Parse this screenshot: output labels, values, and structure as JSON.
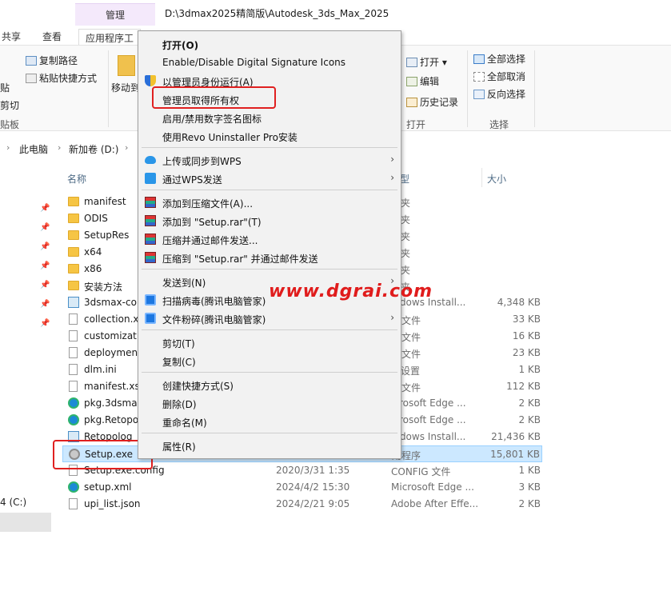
{
  "window": {
    "manage_tab": "管理",
    "title": "D:\\3dmax2025精简版\\Autodesk_3ds_Max_2025",
    "tabs": [
      "共享",
      "查看",
      "应用程序工"
    ]
  },
  "ribbon": {
    "copy_path": "复制路径",
    "paste_shortcut": "粘贴快捷方式",
    "paste_partial": "贴",
    "cut": "剪切",
    "clipboard_label": "贴板",
    "move_to": "移动到",
    "open": "打开",
    "edit": "编辑",
    "history": "历史记录",
    "open_group": "打开",
    "select_all": "全部选择",
    "select_none": "全部取消",
    "invert_select": "反向选择",
    "select_group": "选择"
  },
  "address": {
    "pc": "此电脑",
    "drive": "新加卷 (D:)"
  },
  "nav": {
    "drive_c": "4 (C:)"
  },
  "columns": {
    "name": "名称",
    "type": "型",
    "size": "大小"
  },
  "files": [
    {
      "name": "manifest",
      "date": "",
      "type": "件夹",
      "size": "",
      "icon": "folder"
    },
    {
      "name": "ODIS",
      "date": "",
      "type": "件夹",
      "size": "",
      "icon": "folder"
    },
    {
      "name": "SetupRes",
      "date": "",
      "type": "件夹",
      "size": "",
      "icon": "folder"
    },
    {
      "name": "x64",
      "date": "",
      "type": "件夹",
      "size": "",
      "icon": "folder"
    },
    {
      "name": "x86",
      "date": "",
      "type": "件夹",
      "size": "",
      "icon": "folder"
    },
    {
      "name": "安装方法",
      "date": "",
      "type": "件夹",
      "size": "",
      "icon": "folder"
    },
    {
      "name": "3dsmax-co",
      "date": "",
      "type": "indows Install...",
      "size": "4,348 KB",
      "icon": "package"
    },
    {
      "name": "collection.x",
      "date": "",
      "type": "D 文件",
      "size": "33 KB",
      "icon": "doc"
    },
    {
      "name": "customizat",
      "date": "",
      "type": "D 文件",
      "size": "16 KB",
      "icon": "doc"
    },
    {
      "name": "deploymen",
      "date": "",
      "type": "D 文件",
      "size": "23 KB",
      "icon": "doc"
    },
    {
      "name": "dlm.ini",
      "date": "",
      "type": "置设置",
      "size": "1 KB",
      "icon": "doc"
    },
    {
      "name": "manifest.xs",
      "date": "",
      "type": "D 文件",
      "size": "112 KB",
      "icon": "doc"
    },
    {
      "name": "pkg.3dsma",
      "date": "",
      "type": "icrosoft Edge ...",
      "size": "2 KB",
      "icon": "edge"
    },
    {
      "name": "pkg.Retopo",
      "date": "",
      "type": "icrosoft Edge ...",
      "size": "2 KB",
      "icon": "edge"
    },
    {
      "name": "Retopolog",
      "date": "",
      "type": "indows Install...",
      "size": "21,436 KB",
      "icon": "package"
    },
    {
      "name": "Setup.exe",
      "date": "",
      "type": "用程序",
      "size": "15,801 KB",
      "icon": "gear",
      "selected": true
    },
    {
      "name": "Setup.exe.config",
      "date": "2020/3/31 1:35",
      "type": "CONFIG 文件",
      "size": "1 KB",
      "icon": "doc"
    },
    {
      "name": "setup.xml",
      "date": "2024/4/2 15:30",
      "type": "Microsoft Edge ...",
      "size": "3 KB",
      "icon": "edge"
    },
    {
      "name": "upi_list.json",
      "date": "2024/2/21 9:05",
      "type": "Adobe After Effe...",
      "size": "2 KB",
      "icon": "doc"
    }
  ],
  "menu": {
    "open": "打开(O)",
    "signature_icons": "Enable/Disable Digital Signature Icons",
    "run_as_admin": "以管理员身份运行(A)",
    "take_ownership": "管理员取得所有权",
    "toggle_signature": "启用/禁用数字签名图标",
    "revo": "使用Revo Uninstaller Pro安装",
    "wps_upload": "上传或同步到WPS",
    "wps_send": "通过WPS发送",
    "rar_add": "添加到压缩文件(A)...",
    "rar_add_setup": "添加到 \"Setup.rar\"(T)",
    "rar_email": "压缩并通过邮件发送...",
    "rar_email_setup": "压缩到 \"Setup.rar\" 并通过邮件发送",
    "send_to": "发送到(N)",
    "scan_virus": "扫描病毒(腾讯电脑管家)",
    "shred": "文件粉碎(腾讯电脑管家)",
    "cut": "剪切(T)",
    "copy": "复制(C)",
    "create_shortcut": "创建快捷方式(S)",
    "delete": "删除(D)",
    "rename": "重命名(M)",
    "properties": "属性(R)",
    "arrow": "›"
  },
  "watermark": "www.dgrai.com",
  "colors": {
    "annotation_red": "#e02020",
    "selection": "#cce8ff",
    "manage_tab": "#f4e9fb"
  }
}
